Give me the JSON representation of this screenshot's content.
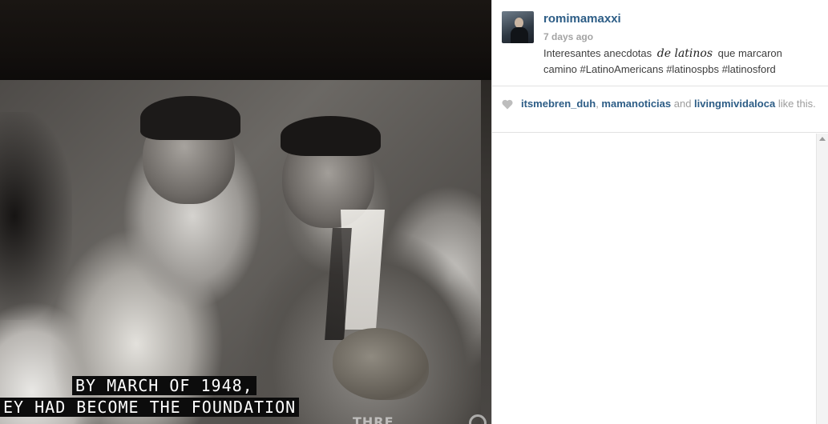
{
  "photo": {
    "caption_line1": "BY MARCH OF 1948,",
    "caption_line2": "EY HAD BECOME THE FOUNDATION",
    "watermark": "THRE"
  },
  "post": {
    "username": "romimamaxxi",
    "timestamp": "7 days ago",
    "text_before": "Interesantes anecdotas",
    "text_script": "de latinos",
    "text_after": "que marcaron camino #LatinoAmericans #latinospbs #latinosford"
  },
  "likes": {
    "icon": "heart-icon",
    "likers": [
      "itsmebren_duh",
      "mamanoticias",
      "livingmividaloca"
    ],
    "sep_comma": ", ",
    "sep_and": " and ",
    "suffix": " like this."
  },
  "colors": {
    "link": "#2d5d86",
    "muted": "#9c9c9c",
    "caption_bg": "#0c0c0c"
  }
}
